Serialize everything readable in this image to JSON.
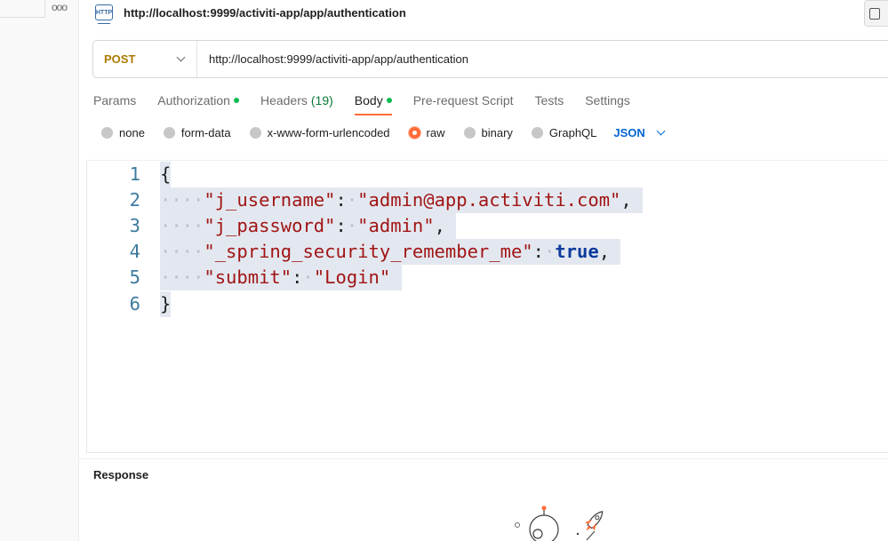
{
  "sidebar": {
    "more_label": "ooo"
  },
  "request": {
    "icon_label": "HTTP",
    "title": "http://localhost:9999/activiti-app/app/authentication",
    "method": "POST",
    "url": "http://localhost:9999/activiti-app/app/authentication"
  },
  "tabs": [
    {
      "label": "Params"
    },
    {
      "label": "Authorization"
    },
    {
      "label": "Headers",
      "count": "(19)"
    },
    {
      "label": "Body"
    },
    {
      "label": "Pre-request Script"
    },
    {
      "label": "Tests"
    },
    {
      "label": "Settings"
    }
  ],
  "body_types": [
    {
      "label": "none"
    },
    {
      "label": "form-data"
    },
    {
      "label": "x-www-form-urlencoded"
    },
    {
      "label": "raw",
      "selected": true
    },
    {
      "label": "binary"
    },
    {
      "label": "GraphQL"
    }
  ],
  "language": "JSON",
  "editor": {
    "line_numbers": [
      "1",
      "2",
      "3",
      "4",
      "5",
      "6"
    ],
    "open_brace": "{",
    "close_brace": "}",
    "entries": [
      {
        "key": "\"j_username\"",
        "value": "\"admin@app.activiti.com\"",
        "trail": ","
      },
      {
        "key": "\"j_password\"",
        "value": "\"admin\"",
        "trail": ","
      },
      {
        "key": "\"_spring_security_remember_me\"",
        "value": "true",
        "trail": ","
      },
      {
        "key": "\"submit\"",
        "value": "\"Login\"",
        "trail": ""
      }
    ]
  },
  "response": {
    "title": "Response"
  },
  "colors": {
    "accent": "#ff6c37",
    "method": "#ad7a03",
    "link": "#0265d2",
    "status_dot": "#0cbb52"
  }
}
